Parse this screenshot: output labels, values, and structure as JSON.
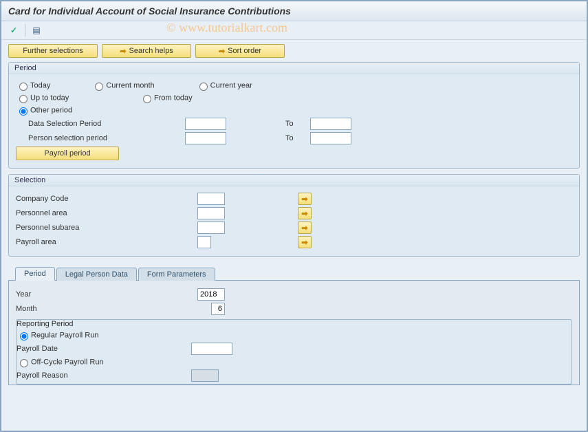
{
  "title": "Card for Individual Account of Social Insurance Contributions",
  "watermark": "© www.tutorialkart.com",
  "buttons": {
    "further_selections": "Further selections",
    "search_helps": "Search helps",
    "sort_order": "Sort order",
    "payroll_period": "Payroll period"
  },
  "period_box": {
    "title": "Period",
    "opts": {
      "today": "Today",
      "current_month": "Current month",
      "current_year": "Current year",
      "up_to_today": "Up to today",
      "from_today": "From today",
      "other_period": "Other period"
    },
    "data_sel": "Data Selection Period",
    "person_sel": "Person selection period",
    "to": "To"
  },
  "selection_box": {
    "title": "Selection",
    "rows": {
      "company_code": "Company Code",
      "personnel_area": "Personnel area",
      "personnel_subarea": "Personnel subarea",
      "payroll_area": "Payroll area"
    }
  },
  "tabs": {
    "period": "Period",
    "legal": "Legal Person Data",
    "form": "Form Parameters"
  },
  "tab_period": {
    "year_lbl": "Year",
    "year_val": "2018",
    "month_lbl": "Month",
    "month_val": "6",
    "rep_title": "Reporting Period",
    "regular": "Regular Payroll Run",
    "payroll_date": "Payroll Date",
    "off_cycle": "Off-Cycle Payroll Run",
    "payroll_reason": "Payroll Reason"
  }
}
